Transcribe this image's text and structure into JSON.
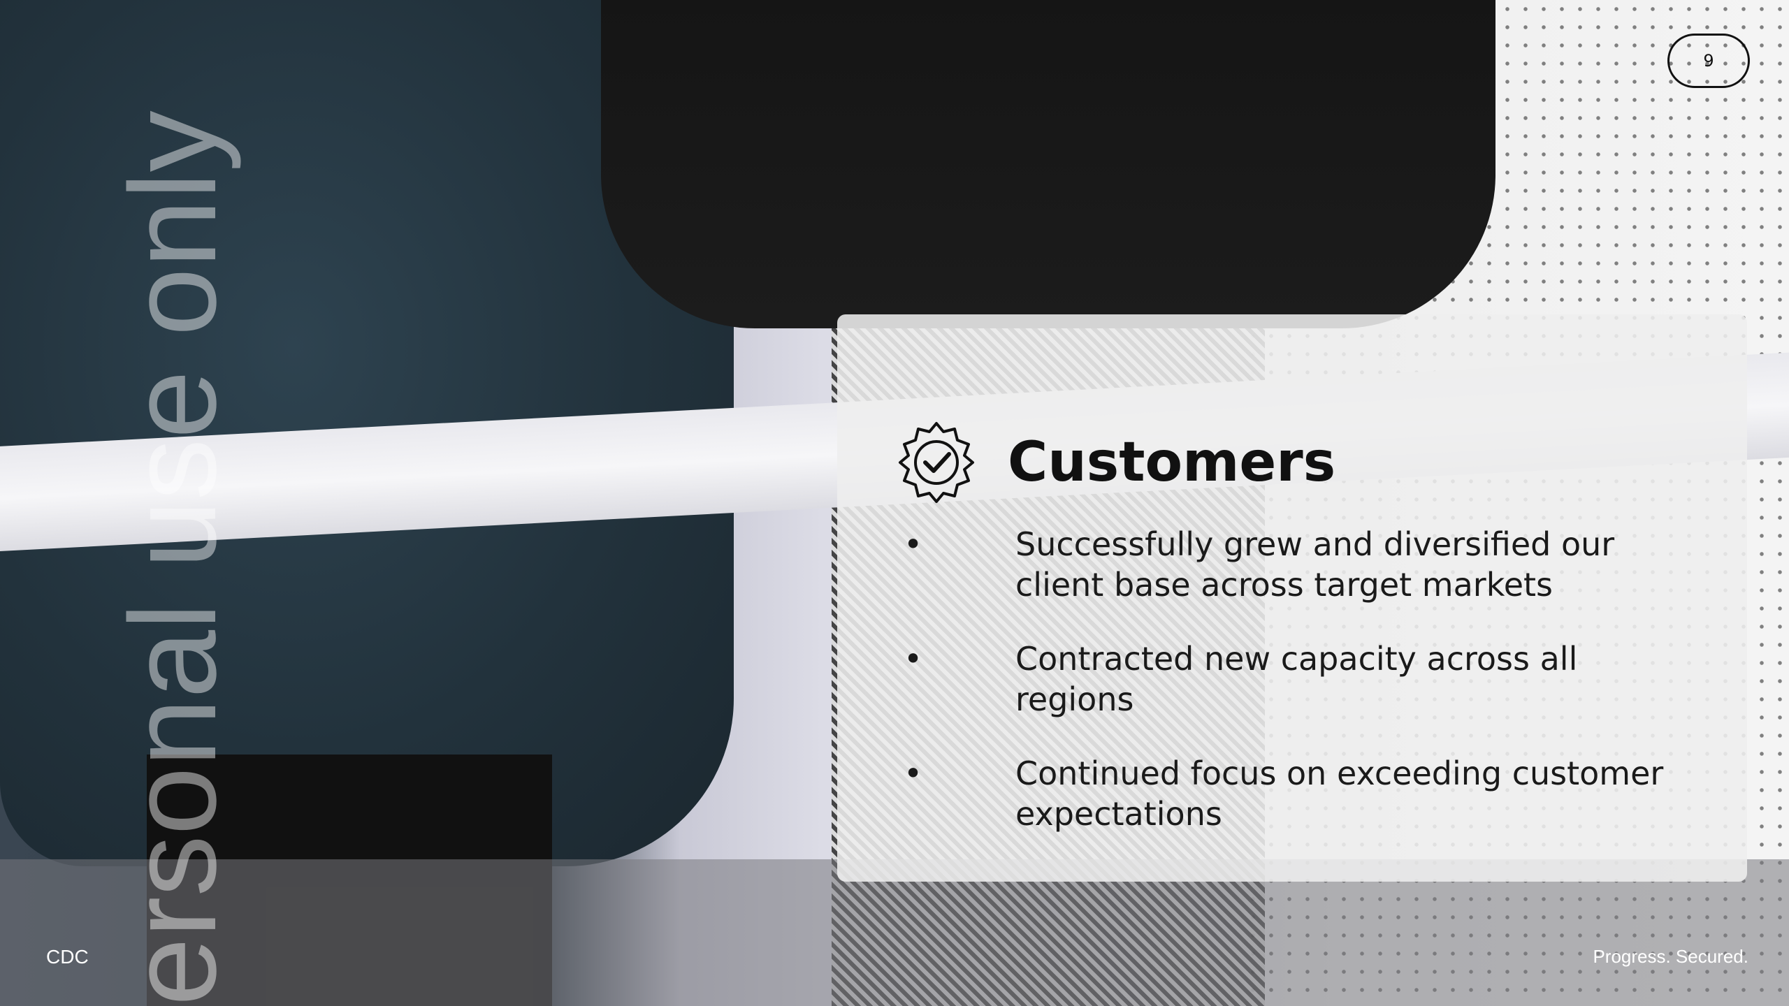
{
  "slide": {
    "page_number": "9",
    "watermark": "ersonal use only",
    "title": "Customers",
    "bullets": [
      "Successfully grew and diversified our client base across target markets",
      "Contracted new capacity across all regions",
      "Continued focus on exceeding customer expectations"
    ],
    "bullet_glyph": "•",
    "footer_left": "CDC",
    "footer_right": "Progress. Secured."
  },
  "icons": {
    "title_icon": "verified-badge-icon"
  },
  "colors": {
    "card_background": "#eeeeee",
    "text": "#111111",
    "footer_text": "#ffffff"
  }
}
